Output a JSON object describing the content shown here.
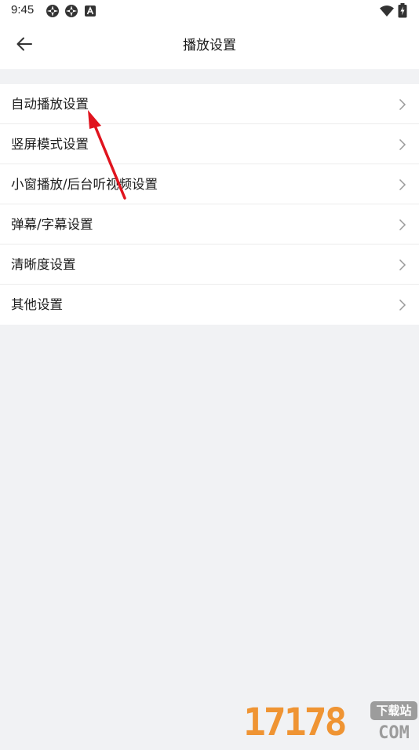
{
  "status_bar": {
    "time": "9:45",
    "icons": [
      "vpn-key-icon",
      "vpn-key-icon",
      "app-notification-icon",
      "wifi-icon",
      "battery-charging-icon"
    ]
  },
  "header": {
    "title": "播放设置",
    "back_icon": "arrow-left-icon"
  },
  "settings": {
    "items": [
      {
        "label": "自动播放设置"
      },
      {
        "label": "竖屏模式设置"
      },
      {
        "label": "小窗播放/后台听视频设置"
      },
      {
        "label": "弹幕/字幕设置"
      },
      {
        "label": "清晰度设置"
      },
      {
        "label": "其他设置"
      }
    ],
    "item_icon": "chevron-right-icon"
  },
  "watermark": {
    "number": "17178",
    "domain": "COM",
    "badge": "下载站"
  },
  "colors": {
    "background": "#f1f2f4",
    "surface": "#ffffff",
    "annotation_arrow": "#e0141e",
    "watermark_orange": "#ef8a1f",
    "watermark_gray": "#9c9c9c"
  }
}
